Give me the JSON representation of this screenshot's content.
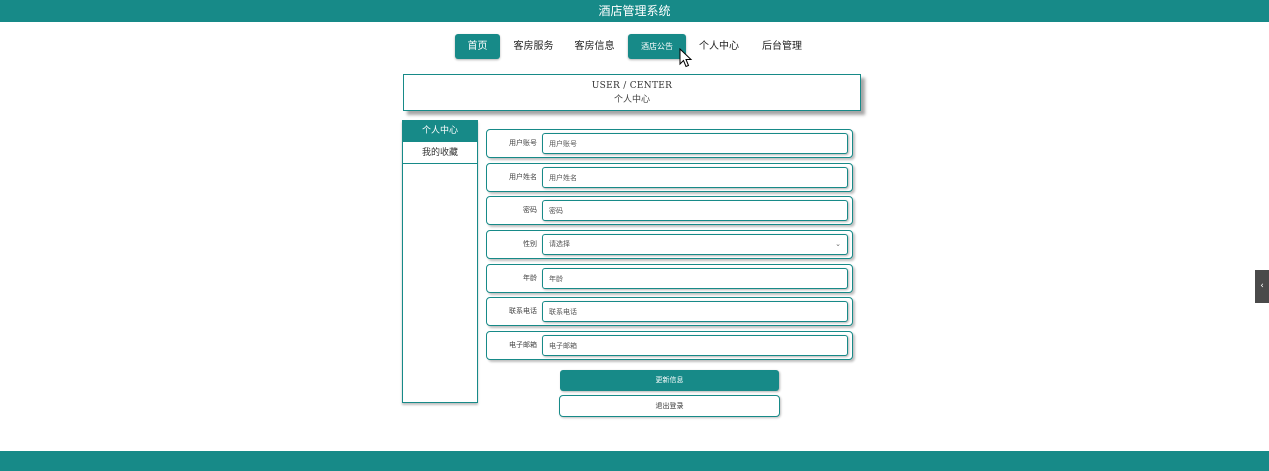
{
  "app": {
    "title": "酒店管理系统"
  },
  "nav": {
    "items": [
      {
        "label": "首页",
        "active": true
      },
      {
        "label": "客房服务",
        "active": false
      },
      {
        "label": "客房信息",
        "active": false
      },
      {
        "label": "酒店公告",
        "active": true,
        "hovered": true
      },
      {
        "label": "个人中心",
        "active": false
      },
      {
        "label": "后台管理",
        "active": false
      }
    ]
  },
  "header": {
    "en": "USER / CENTER",
    "cn": "个人中心"
  },
  "sidebar": {
    "items": [
      {
        "label": "个人中心",
        "active": true
      },
      {
        "label": "我的收藏",
        "active": false
      }
    ]
  },
  "form": {
    "fields": [
      {
        "label": "用户账号",
        "placeholder": "用户账号",
        "type": "text"
      },
      {
        "label": "用户姓名",
        "placeholder": "用户姓名",
        "type": "text"
      },
      {
        "label": "密码",
        "placeholder": "密码",
        "type": "text"
      },
      {
        "label": "性别",
        "placeholder": "请选择",
        "type": "select"
      },
      {
        "label": "年龄",
        "placeholder": "年龄",
        "type": "text"
      },
      {
        "label": "联系电话",
        "placeholder": "联系电话",
        "type": "text"
      },
      {
        "label": "电子邮箱",
        "placeholder": "电子邮箱",
        "type": "text"
      }
    ],
    "update_label": "更新信息",
    "logout_label": "退出登录"
  },
  "side_tab": {
    "icon": "chevron-left-icon",
    "glyph": "‹"
  },
  "colors": {
    "primary": "#178a88",
    "text": "#333333",
    "side_tab": "#4a4a4a"
  }
}
